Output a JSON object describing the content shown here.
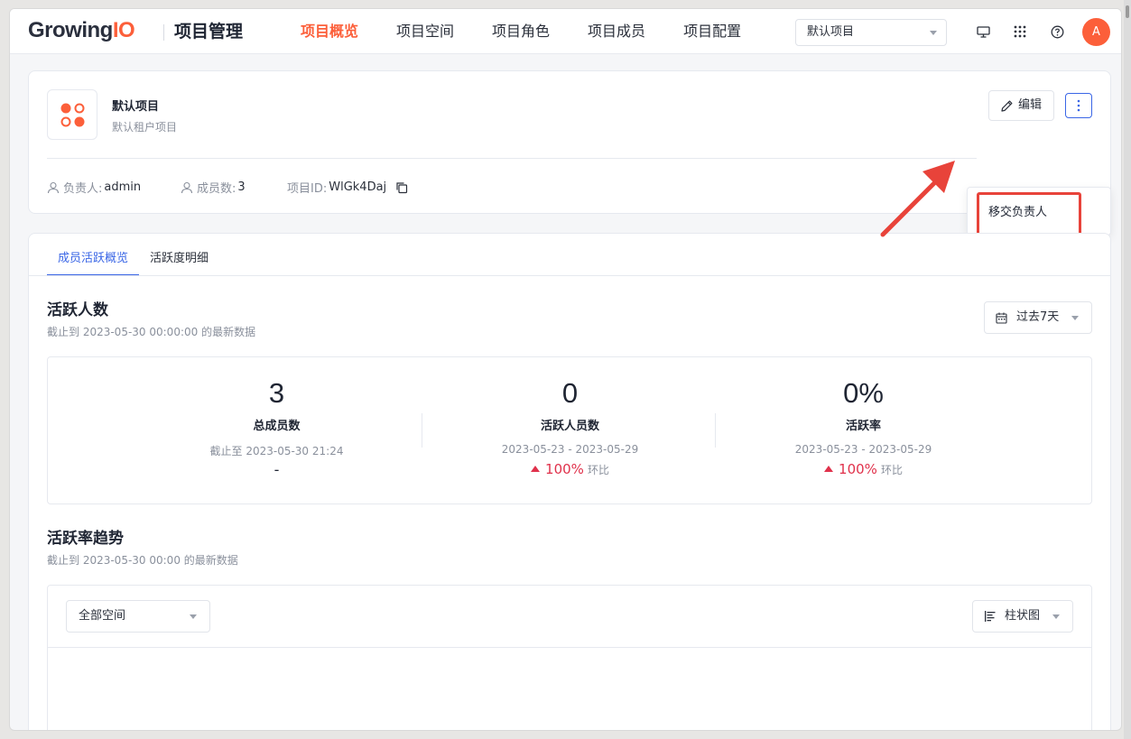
{
  "header": {
    "logo_text": "Growing",
    "logo_accent": "IO",
    "app_title": "项目管理",
    "nav": [
      {
        "label": "项目概览",
        "active": true
      },
      {
        "label": "项目空间",
        "active": false
      },
      {
        "label": "项目角色",
        "active": false
      },
      {
        "label": "项目成员",
        "active": false
      },
      {
        "label": "项目配置",
        "active": false
      }
    ],
    "project_select": "默认项目",
    "avatar_letter": "A",
    "icons": [
      "monitor-icon",
      "apps-grid-icon",
      "help-icon"
    ]
  },
  "project": {
    "name": "默认项目",
    "description": "默认租户项目",
    "edit_label": "编辑",
    "owner_label": "负责人:",
    "owner": "admin",
    "members_label": "成员数:",
    "members": "3",
    "id_label": "项目ID:",
    "id": "WlGk4Daj"
  },
  "more_menu": {
    "items": [
      "移交负责人"
    ]
  },
  "tabs": [
    {
      "label": "成员活跃概览",
      "active": true
    },
    {
      "label": "活跃度明细",
      "active": false
    }
  ],
  "active_users": {
    "title": "活跃人数",
    "subtitle": "截止到 2023-05-30 00:00:00 的最新数据",
    "range_label": "过去7天",
    "stats": [
      {
        "value": "3",
        "label": "总成员数",
        "note": "截止至 2023-05-30 21:24",
        "change": "-",
        "compare": ""
      },
      {
        "value": "0",
        "label": "活跃人员数",
        "note": "2023-05-23 - 2023-05-29",
        "change": "100%",
        "compare": "环比"
      },
      {
        "value": "0%",
        "label": "活跃率",
        "note": "2023-05-23 - 2023-05-29",
        "change": "100%",
        "compare": "环比"
      }
    ]
  },
  "trend": {
    "title": "活跃率趋势",
    "subtitle": "截止到 2023-05-30 00:00 的最新数据",
    "space_select": "全部空间",
    "chart_type_select": "柱状图"
  },
  "colors": {
    "brand": "#fc5f3a",
    "primary": "#3a66e6",
    "up": "#e0314b",
    "highlight": "#e8433a"
  }
}
